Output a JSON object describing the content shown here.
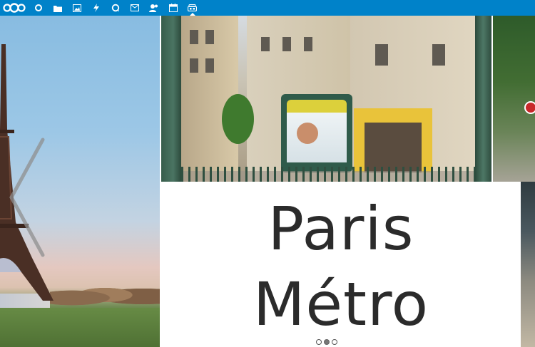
{
  "topbar": {
    "accent": "#0082c9",
    "apps": [
      {
        "icon": "dashboard-icon",
        "active": false
      },
      {
        "icon": "folder-icon",
        "active": false
      },
      {
        "icon": "image-icon",
        "active": false
      },
      {
        "icon": "activity-icon",
        "active": false
      },
      {
        "icon": "talk-icon",
        "active": false
      },
      {
        "icon": "mail-icon",
        "active": false
      },
      {
        "icon": "contacts-icon",
        "active": false
      },
      {
        "icon": "calendar-icon",
        "active": false
      },
      {
        "icon": "deck-icon",
        "active": true
      }
    ]
  },
  "slideshow": {
    "title_line1": "Paris",
    "title_line2": "Métro",
    "pagination": {
      "count": 3,
      "active_index": 1
    }
  }
}
